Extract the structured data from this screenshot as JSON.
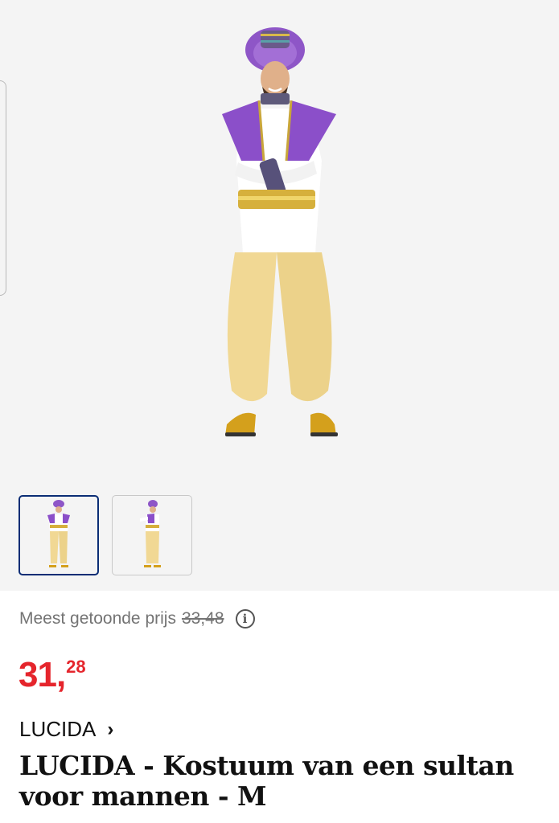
{
  "gallery": {
    "main_image_icon": "sultan-costume-photo",
    "thumbnails": [
      {
        "icon": "sultan-costume-front-thumbnail",
        "selected": true
      },
      {
        "icon": "sultan-costume-side-thumbnail",
        "selected": false
      }
    ]
  },
  "pricing": {
    "reference_label": "Meest getoonde prijs",
    "reference_price": "33,48",
    "info_icon": "info-icon",
    "price_euros": "31,",
    "price_cents": "28",
    "price_color": "#e5252c"
  },
  "product": {
    "brand": "LUCIDA",
    "brand_chevron": "›",
    "title": "LUCIDA - Kostuum van een sultan voor mannen - M"
  },
  "colors": {
    "selected_thumbnail_border": "#0b2d75",
    "gallery_background": "#f4f4f4"
  }
}
